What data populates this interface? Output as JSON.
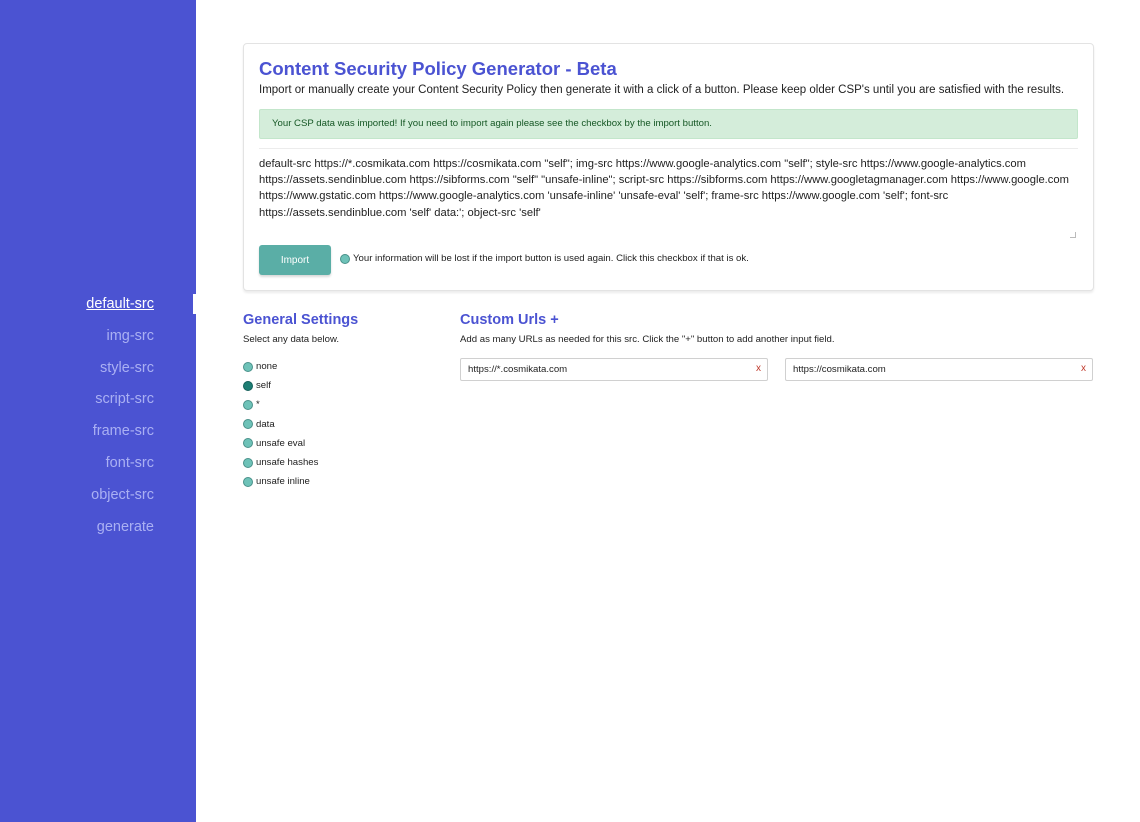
{
  "sidebar": {
    "items": [
      {
        "label": "default-src"
      },
      {
        "label": "img-src"
      },
      {
        "label": "style-src"
      },
      {
        "label": "script-src"
      },
      {
        "label": "frame-src"
      },
      {
        "label": "font-src"
      },
      {
        "label": "object-src"
      },
      {
        "label": "generate"
      }
    ],
    "active": "default-src"
  },
  "header": {
    "title": "Content Security Policy Generator - Beta",
    "subtitle": "Import or manually create your Content Security Policy then generate it with a click of a button. Please keep older CSP's until you are satisfied with the results."
  },
  "alert": {
    "text": "Your CSP data was imported! If you need to import again please see the checkbox by the import button."
  },
  "import": {
    "csp_value": "default-src https://*.cosmikata.com https://cosmikata.com \"self\"; img-src https://www.google-analytics.com \"self\"; style-src https://www.google-analytics.com https://assets.sendinblue.com https://sibforms.com \"self\" \"unsafe-inline\"; script-src https://sibforms.com https://www.googletagmanager.com https://www.google.com https://www.gstatic.com https://www.google-analytics.com 'unsafe-inline' 'unsafe-eval' 'self'; frame-src https://www.google.com 'self'; font-src https://assets.sendinblue.com 'self' data:'; object-src 'self'",
    "button_label": "Import",
    "warning": "Your information will be lost if the import button is used again. Click this checkbox if that is ok."
  },
  "general_settings": {
    "title": "General Settings",
    "description": "Select any data below.",
    "options": [
      {
        "label": "none",
        "checked": false
      },
      {
        "label": "self",
        "checked": true
      },
      {
        "label": "*",
        "checked": false
      },
      {
        "label": "data",
        "checked": false
      },
      {
        "label": "unsafe eval",
        "checked": false
      },
      {
        "label": "unsafe hashes",
        "checked": false
      },
      {
        "label": "unsafe inline",
        "checked": false
      }
    ]
  },
  "custom_urls": {
    "title": "Custom Urls +",
    "description": "Add as many URLs as needed for this src. Click the \"+\" button to add another input field.",
    "urls": [
      {
        "value": "https://*.cosmikata.com",
        "remove_label": "x"
      },
      {
        "value": "https://cosmikata.com",
        "remove_label": "x"
      }
    ]
  },
  "colors": {
    "sidebar_bg": "#4b53d2",
    "accent": "#4b53d2",
    "button_bg": "#5aaea6",
    "alert_bg": "#d4edda"
  }
}
